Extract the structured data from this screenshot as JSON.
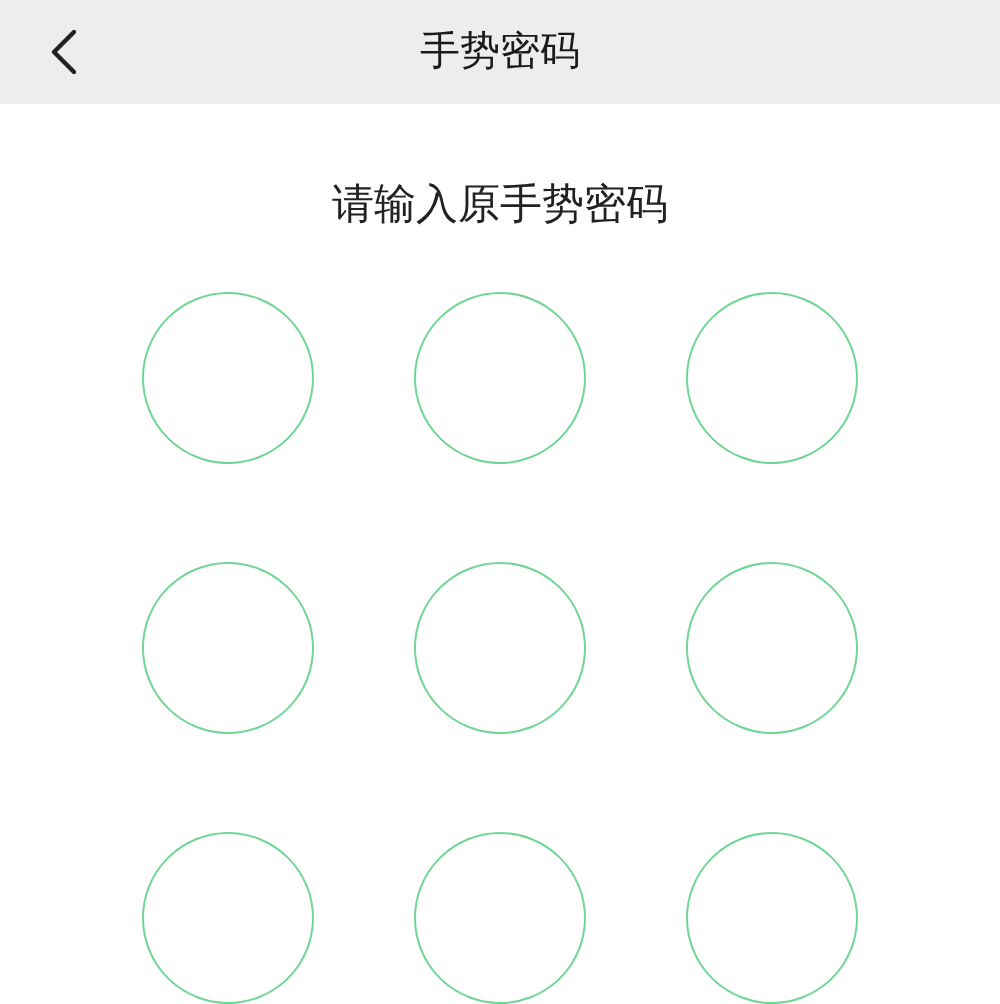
{
  "header": {
    "title": "手势密码"
  },
  "prompt": "请输入原手势密码",
  "nodes": [
    {
      "selected": false
    },
    {
      "selected": false
    },
    {
      "selected": false
    },
    {
      "selected": false
    },
    {
      "selected": false
    },
    {
      "selected": false
    },
    {
      "selected": false
    },
    {
      "selected": false
    },
    {
      "selected": false
    }
  ]
}
